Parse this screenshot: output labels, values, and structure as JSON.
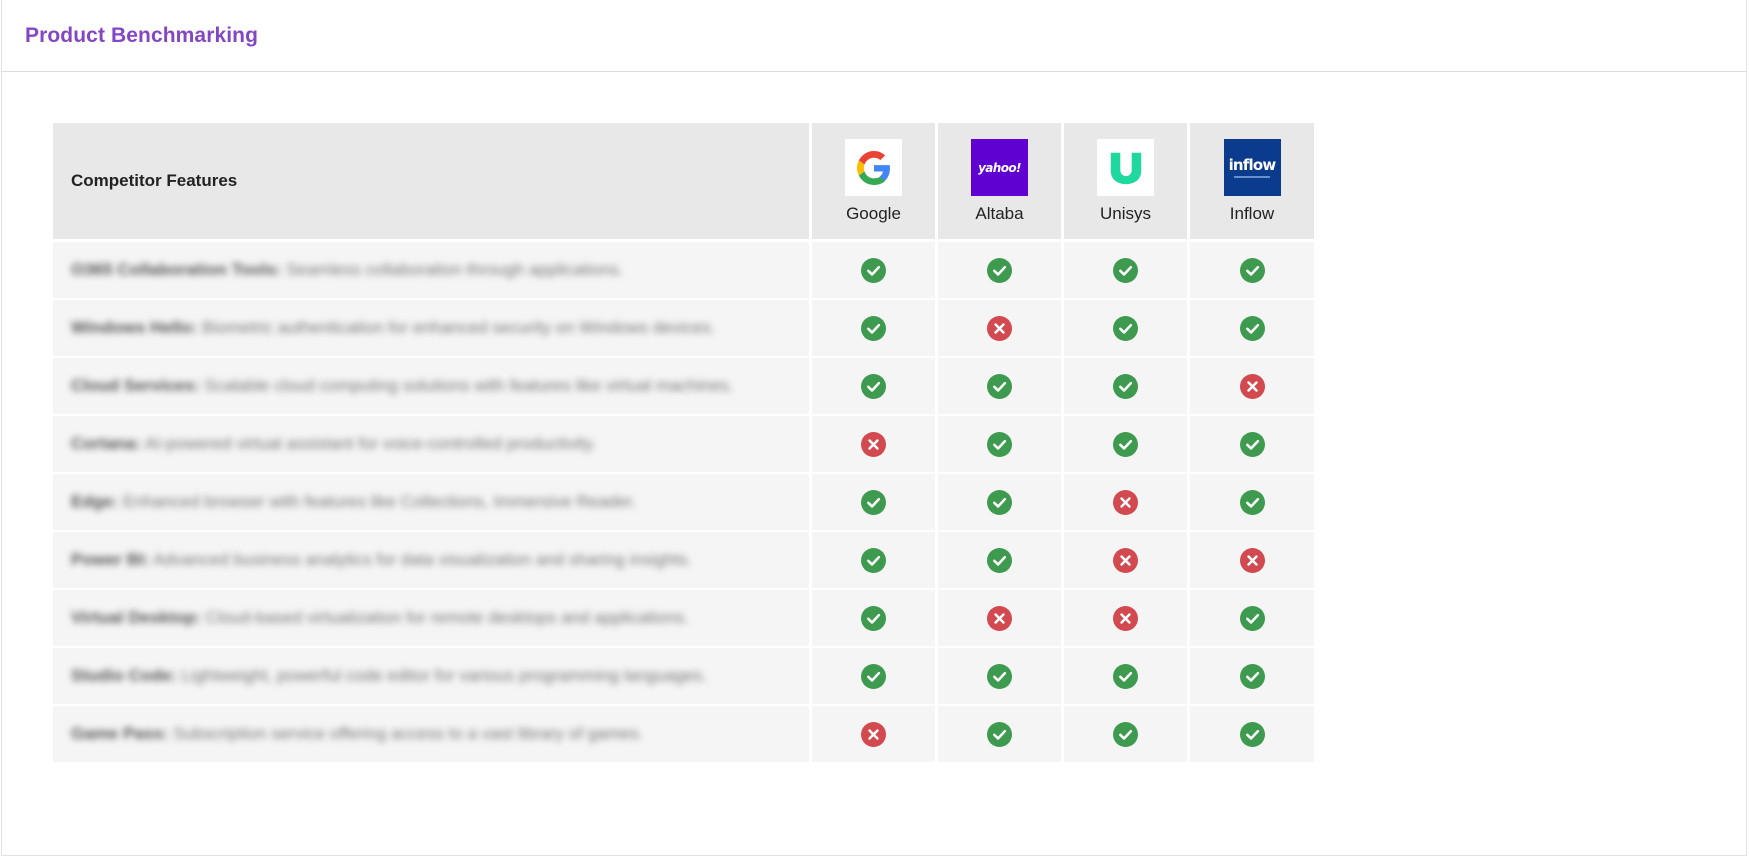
{
  "header": {
    "title": "Product Benchmarking"
  },
  "table": {
    "feature_header": "Competitor Features",
    "competitors": [
      {
        "name": "Google",
        "logo_icon": "google-logo-icon",
        "logo_color": "#ffffff"
      },
      {
        "name": "Altaba",
        "logo_icon": "yahoo-logo-icon",
        "logo_text": "yahoo!",
        "logo_color": "#5f01d1"
      },
      {
        "name": "Unisys",
        "logo_icon": "unisys-logo-icon",
        "logo_color": "#ffffff",
        "logo_accent": "#1ed8a0"
      },
      {
        "name": "Inflow",
        "logo_icon": "inflow-logo-icon",
        "logo_text": "inflow",
        "logo_color": "#0b3b8c"
      }
    ],
    "rows": [
      {
        "feature": "O365 Collaboration Tools:",
        "description": "Seamless collaboration through applications.",
        "marks": [
          true,
          true,
          true,
          true
        ]
      },
      {
        "feature": "Windows Hello:",
        "description": "Biometric authentication for enhanced security on Windows devices.",
        "marks": [
          true,
          false,
          true,
          true
        ]
      },
      {
        "feature": "Cloud Services:",
        "description": "Scalable cloud computing solutions with features like virtual machines.",
        "marks": [
          true,
          true,
          true,
          false
        ]
      },
      {
        "feature": "Cortana:",
        "description": "AI-powered virtual assistant for voice-controlled productivity.",
        "marks": [
          false,
          true,
          true,
          true
        ]
      },
      {
        "feature": "Edge:",
        "description": "Enhanced browser with features like Collections, Immersive Reader.",
        "marks": [
          true,
          true,
          false,
          true
        ]
      },
      {
        "feature": "Power BI:",
        "description": "Advanced business analytics for data visualization and sharing insights.",
        "marks": [
          true,
          true,
          false,
          false
        ]
      },
      {
        "feature": "Virtual Desktop:",
        "description": "Cloud-based virtualization for remote desktops and applications.",
        "marks": [
          true,
          false,
          false,
          true
        ]
      },
      {
        "feature": "Studio Code:",
        "description": "Lightweight, powerful code editor for various programming languages.",
        "marks": [
          true,
          true,
          true,
          true
        ]
      },
      {
        "feature": "Game Pass:",
        "description": "Subscription service offering access to a vast library of games.",
        "marks": [
          false,
          true,
          true,
          true
        ]
      }
    ]
  },
  "colors": {
    "accent": "#8447c4",
    "check": "#3e9a4f",
    "cross": "#d24a4f"
  },
  "icons": {
    "yes": "check-circle-icon",
    "no": "x-circle-icon"
  }
}
